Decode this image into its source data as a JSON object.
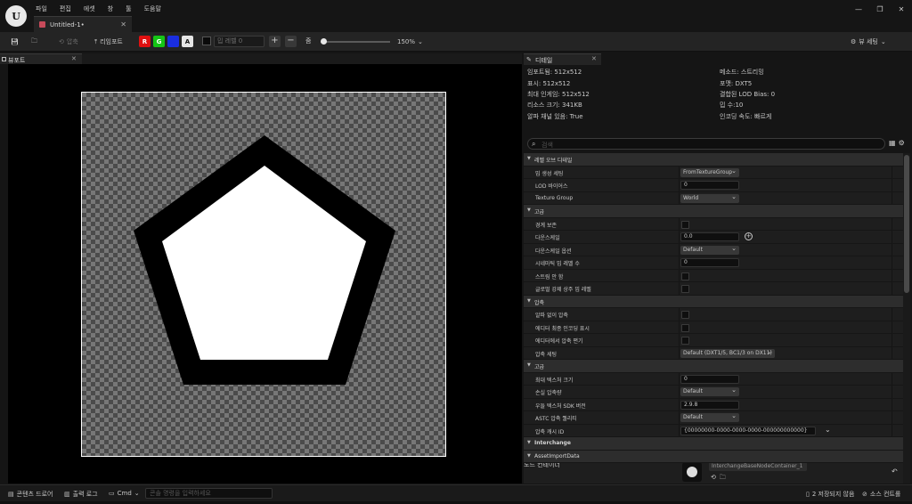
{
  "app": {
    "logo_glyph": "U",
    "menu": [
      "파일",
      "편집",
      "에셋",
      "창",
      "툴",
      "도움말"
    ],
    "document_tab": "Untitled-1•",
    "window_controls": [
      "—",
      "❐",
      "✕"
    ]
  },
  "toolbar": {
    "compress_label": "압축",
    "reimport_label": "리임포트",
    "channels": [
      {
        "label": "R",
        "color": "#e01010",
        "text_color": "#ffffff"
      },
      {
        "label": "G",
        "color": "#15c515",
        "text_color": "#ffffff"
      },
      {
        "label": "B",
        "color": "#1a2ee0",
        "text_color": "#1a2ee0"
      },
      {
        "label": "A",
        "color": "#e6e6e6",
        "text_color": "#111111"
      }
    ],
    "mip_level_label": "밉 레벨 0",
    "zoom_label": "줌",
    "zoom_fraction": 0.04,
    "zoom_value": "150%",
    "view_settings_label": "뷰 세팅"
  },
  "viewport": {
    "tab_label": "뷰포트",
    "colors": {
      "background": "#000000",
      "border": "#ffffff",
      "pentagon_outline": "#000000",
      "pentagon_fill": "#ffffff"
    }
  },
  "details": {
    "tab_label": "디테일",
    "info_left": [
      "임포트됨: 512x512",
      "표시: 512x512",
      "최대 인게임: 512x512",
      "리소스 크기: 341KB",
      "알파 채널 있음: True"
    ],
    "info_right": [
      "메소드: 스트리밍",
      "포맷: DXT5",
      "결합된 LOD Bias: 0",
      "밉 수:10",
      "인코딩 속도: 빠르게"
    ],
    "search_placeholder": "검색",
    "rows": [
      {
        "type": "cat",
        "label": "레벨 오브 디테일"
      },
      {
        "type": "item",
        "label": "밉 생성 세팅",
        "control": "drop",
        "value": "FromTextureGroup",
        "w": 66
      },
      {
        "type": "item",
        "label": "LOD 바이어스",
        "control": "box",
        "value": "0",
        "w": 66
      },
      {
        "type": "item",
        "label": "Texture Group",
        "control": "drop",
        "value": "World",
        "w": 66
      },
      {
        "type": "cat",
        "label": "고급"
      },
      {
        "type": "item",
        "label": "경계 보존",
        "control": "check"
      },
      {
        "type": "item",
        "label": "다운스케일",
        "control": "box",
        "value": "0.0",
        "w": 66,
        "extra": "plus"
      },
      {
        "type": "item",
        "label": "다운스케일 옵션",
        "control": "drop",
        "value": "Default",
        "w": 66
      },
      {
        "type": "item",
        "label": "시네마틱 밉 레벨 수",
        "control": "box",
        "value": "0",
        "w": 66
      },
      {
        "type": "item",
        "label": "스트림 안 함",
        "control": "check"
      },
      {
        "type": "item",
        "label": "글로벌 강제 상주 밉 레벨",
        "control": "check"
      },
      {
        "type": "cat",
        "label": "압축"
      },
      {
        "type": "item",
        "label": "알파 없이 압축",
        "control": "check"
      },
      {
        "type": "item",
        "label": "에디터 최종 인코딩 표시",
        "control": "check"
      },
      {
        "type": "item",
        "label": "에디터에서 압축 편기",
        "control": "check"
      },
      {
        "type": "item",
        "label": "압축 세팅",
        "control": "drop",
        "value": "Default (DXT1/5, BC1/3 on DX11)",
        "w": 106
      },
      {
        "type": "cat",
        "label": "고급"
      },
      {
        "type": "item",
        "label": "최대 텍스처 크기",
        "control": "box",
        "value": "0",
        "w": 66
      },
      {
        "type": "item",
        "label": "손실 압축량",
        "control": "drop",
        "value": "Default",
        "w": 66
      },
      {
        "type": "item",
        "label": "우들 텍스처 SDK 버전",
        "control": "box",
        "value": "2.9.8",
        "w": 66
      },
      {
        "type": "item",
        "label": "ASTC 압축 퀄리티",
        "control": "drop",
        "value": "Default",
        "w": 66
      },
      {
        "type": "item",
        "label": "압축 캐시 ID",
        "control": "box",
        "value": "{00000000-0000-0000-0000-000000000000}",
        "w": 152,
        "extra": "chev"
      },
      {
        "type": "cat",
        "label": "Interchange",
        "bold": true
      },
      {
        "type": "cat",
        "label": "AssetImportData"
      }
    ],
    "node": {
      "label": "노드 컨테이너",
      "value": "InterchangeBaseNodeContainer_1"
    }
  },
  "statusbar": {
    "content_drawer": "콘텐츠 드로어",
    "output_log": "출력 로그",
    "cmd": "Cmd",
    "cmd_placeholder": "콘솔 명령을 입력하세요",
    "unsaved": "2 저장되지 않음",
    "source_control": "소스 컨트롤"
  }
}
